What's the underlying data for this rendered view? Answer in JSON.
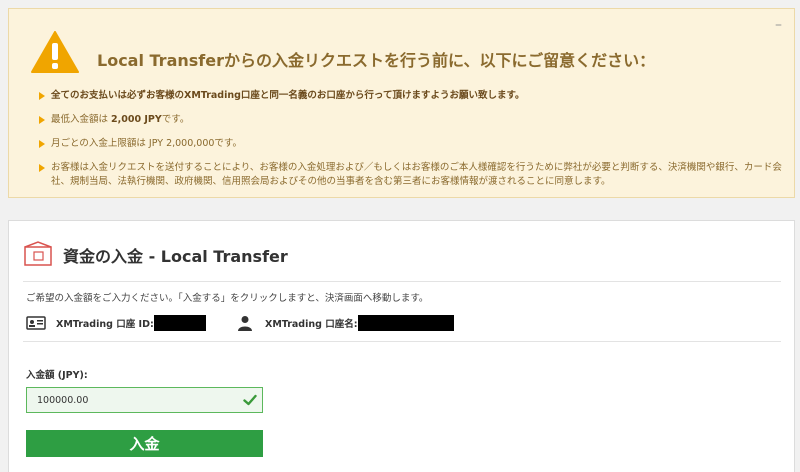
{
  "notice": {
    "collapse_symbol": "–",
    "icon": "warning-triangle-icon",
    "title": "Local Transferからの入金リクエストを行う前に、以下にご留意ください：",
    "items": [
      {
        "text": "全てのお支払いは必ずお客様のXMTrading口座と同一名義のお口座から行って頂けますようお願い致します。"
      },
      {
        "prefix": "最低入金額は ",
        "bold": "2,000 JPY",
        "suffix": "です。"
      },
      {
        "text": "月ごとの入金上限額は JPY 2,000,000です。"
      },
      {
        "text": "お客様は入金リクエストを送付することにより、お客様の入金処理および／もしくはお客様のご本人様確認を行うために弊社が必要と判断する、決済機関や銀行、カード会社、規制当局、法執行機関、政府機関、信用照会局およびその他の当事者を含む第三者にお客様情報が渡されることに同意します。"
      }
    ]
  },
  "deposit": {
    "icon": "wallet-icon",
    "title": "資金の入金 - Local Transfer",
    "instruction": "ご希望の入金額をご入力ください。「入金する」をクリックしますと、決済画面へ移動します。",
    "account_id_label": "XMTrading 口座 ID:",
    "account_name_label": "XMTrading 口座名:",
    "amount_label": "入金額 (JPY):",
    "amount_value": "100000.00",
    "submit_label": "入金"
  },
  "colors": {
    "notice_bg": "#fcf3dc",
    "notice_text": "#8a6a2e",
    "bullet": "#f0a500",
    "warning": "#f0a500",
    "submit": "#2e9e43",
    "valid": "#5cb85c"
  }
}
